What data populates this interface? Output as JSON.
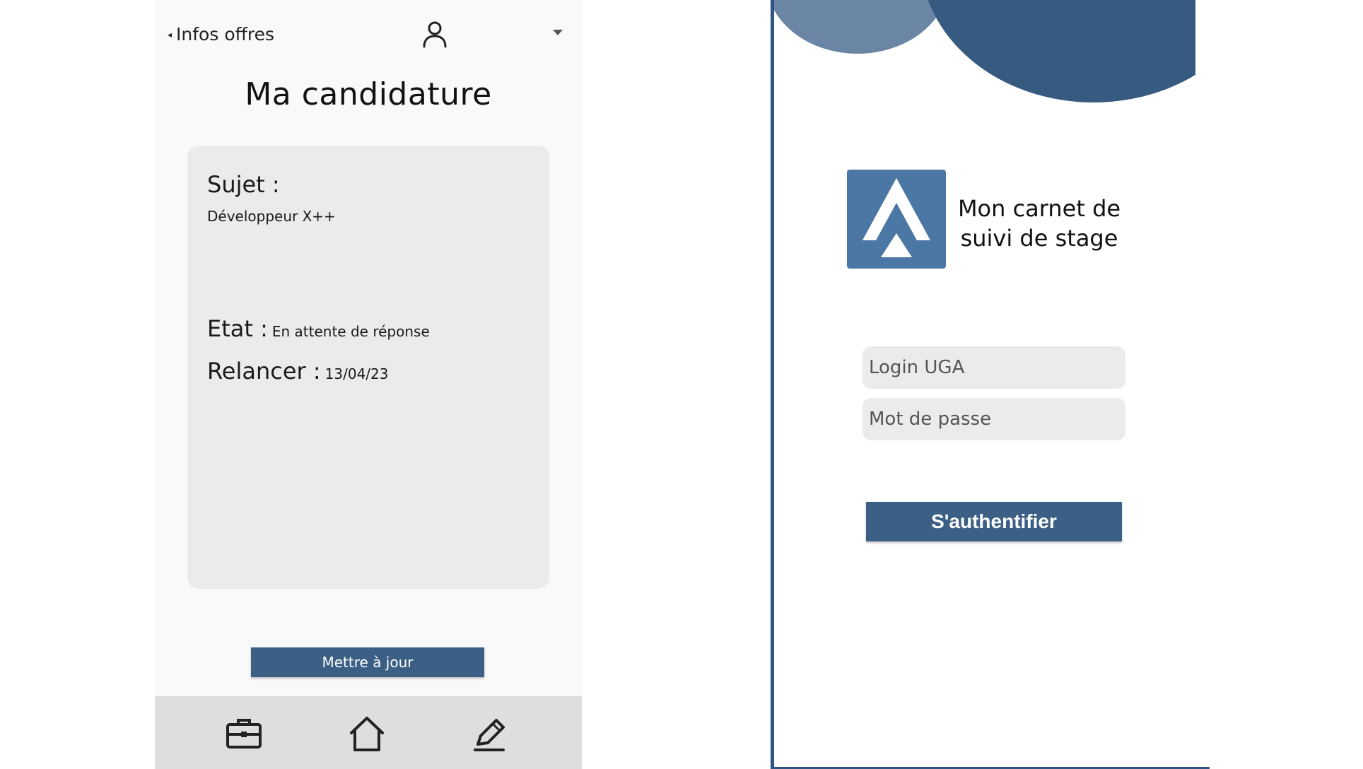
{
  "colors": {
    "primary": "#3b5f85",
    "primary_dark": "#365a80",
    "deco_light": "#6b86a4",
    "logo_blue": "#4a77a3",
    "card_bg": "#ebebeb",
    "nav_bg": "#dedede"
  },
  "left_screen": {
    "header": {
      "back_label": "Infos offres",
      "back_icon": "caret-left-icon",
      "user_icon": "user-icon",
      "menu_icon": "chevron-down-icon"
    },
    "title": "Ma candidature",
    "card": {
      "subject_label": "Sujet :",
      "subject_value": "Développeur X++",
      "state_label": "Etat :",
      "state_value": "En attente de réponse",
      "followup_label": "Relancer :",
      "followup_value": "13/04/23"
    },
    "update_button": "Mettre à jour",
    "bottom_nav": {
      "items": [
        {
          "icon": "briefcase-icon"
        },
        {
          "icon": "home-icon"
        },
        {
          "icon": "pencil-icon"
        }
      ]
    }
  },
  "right_screen": {
    "logo_icon": "app-logo-icon",
    "brand_line1": "Mon carnet de",
    "brand_line2": "suivi de stage",
    "login_placeholder": "Login UGA",
    "password_placeholder": "Mot de passe",
    "auth_button": "S'authentifier"
  }
}
